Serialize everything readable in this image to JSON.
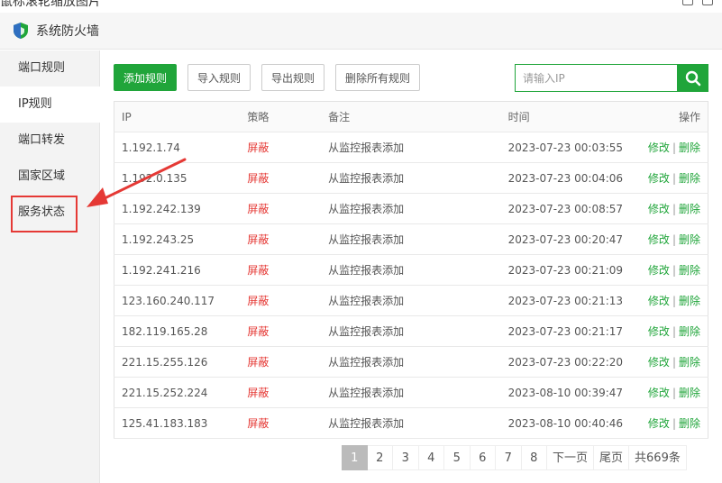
{
  "top_strip": {
    "cut_title": "鼠标滚轮缩放图片"
  },
  "window": {
    "title": "系统防火墙"
  },
  "sidebar": {
    "items": [
      {
        "label": "端口规则"
      },
      {
        "label": "IP规则"
      },
      {
        "label": "端口转发"
      },
      {
        "label": "国家区域"
      },
      {
        "label": "服务状态"
      }
    ]
  },
  "toolbar": {
    "add": "添加规则",
    "import": "导入规则",
    "export": "导出规则",
    "delete_all": "删除所有规则"
  },
  "search": {
    "placeholder": "请输入IP"
  },
  "table": {
    "headers": {
      "ip": "IP",
      "policy": "策略",
      "note": "备注",
      "time": "时间",
      "op": "操作"
    },
    "edit": "修改",
    "sep": "|",
    "delete": "删除",
    "rows": [
      {
        "ip": "1.192.1.74",
        "policy": "屏蔽",
        "note": "从监控报表添加",
        "time": "2023-07-23 00:03:55"
      },
      {
        "ip": "1.192.0.135",
        "policy": "屏蔽",
        "note": "从监控报表添加",
        "time": "2023-07-23 00:04:06"
      },
      {
        "ip": "1.192.242.139",
        "policy": "屏蔽",
        "note": "从监控报表添加",
        "time": "2023-07-23 00:08:57"
      },
      {
        "ip": "1.192.243.25",
        "policy": "屏蔽",
        "note": "从监控报表添加",
        "time": "2023-07-23 00:20:47"
      },
      {
        "ip": "1.192.241.216",
        "policy": "屏蔽",
        "note": "从监控报表添加",
        "time": "2023-07-23 00:21:09"
      },
      {
        "ip": "123.160.240.117",
        "policy": "屏蔽",
        "note": "从监控报表添加",
        "time": "2023-07-23 00:21:13"
      },
      {
        "ip": "182.119.165.28",
        "policy": "屏蔽",
        "note": "从监控报表添加",
        "time": "2023-07-23 00:21:17"
      },
      {
        "ip": "221.15.255.126",
        "policy": "屏蔽",
        "note": "从监控报表添加",
        "time": "2023-07-23 00:22:20"
      },
      {
        "ip": "221.15.252.224",
        "policy": "屏蔽",
        "note": "从监控报表添加",
        "time": "2023-08-10 00:39:47"
      },
      {
        "ip": "125.41.183.183",
        "policy": "屏蔽",
        "note": "从监控报表添加",
        "time": "2023-08-10 00:40:46"
      }
    ]
  },
  "pager": {
    "pages": [
      "1",
      "2",
      "3",
      "4",
      "5",
      "6",
      "7",
      "8"
    ],
    "current": "1",
    "next": "下一页",
    "last": "尾页",
    "total": "共669条"
  },
  "colors": {
    "accent": "#20a53a",
    "danger": "#e53935",
    "annotation": "#e53935"
  },
  "icons": {
    "app": "shield-icon",
    "search": "search-icon",
    "annotation": "arrow-annotation"
  }
}
